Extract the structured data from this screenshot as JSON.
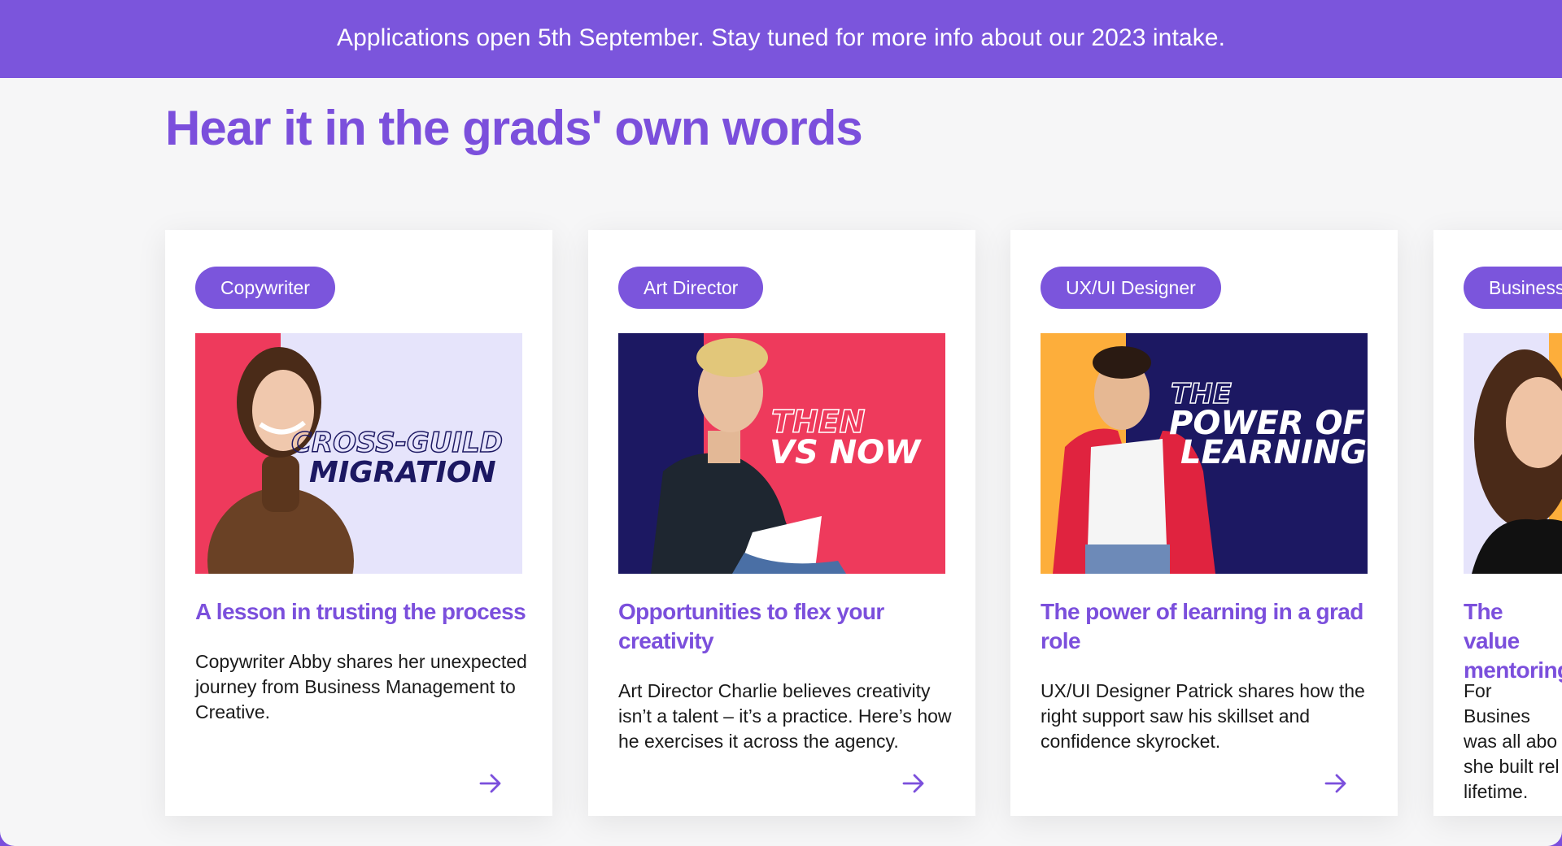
{
  "banner": {
    "text": "Applications open 5th September. Stay tuned for more info about our 2023 intake."
  },
  "section": {
    "title": "Hear it in the grads' own words"
  },
  "colors": {
    "accent": "#7b4fdc",
    "banner_bg": "#7b55dc",
    "panel_bg": "#f6f6f7",
    "card_bg": "#ffffff",
    "pink": "#ee3a5c",
    "navy": "#1c1862",
    "lavender": "#e6e4fb",
    "orange": "#fdae3b"
  },
  "cards": [
    {
      "tag": "Copywriter",
      "thumb_text_1": "CROSS-GUILD",
      "thumb_text_2": "MIGRATION",
      "title": "A lesson in trusting the process",
      "description": "Copywriter Abby shares her unexpected journey from Business Management to Creative.",
      "link_icon": "arrow-right-icon"
    },
    {
      "tag": "Art Director",
      "thumb_text_1": "THEN",
      "thumb_text_2": "VS NOW",
      "title": "Opportunities to flex your creativity",
      "description": "Art Director Charlie believes creativity isn’t a talent – it’s a practice. Here’s how he exercises it across the agency.",
      "link_icon": "arrow-right-icon"
    },
    {
      "tag": "UX/UI Designer",
      "thumb_text_1": "THE",
      "thumb_text_2": "POWER OF",
      "thumb_text_3": "LEARNING",
      "title": "The power of learning in a grad role",
      "description": "UX/UI Designer Patrick shares how the right support saw his skillset and confidence skyrocket.",
      "link_icon": "arrow-right-icon"
    },
    {
      "tag": "Business",
      "title": "The value mentoring",
      "description": "For Busines was all abo she built rel lifetime."
    }
  ]
}
